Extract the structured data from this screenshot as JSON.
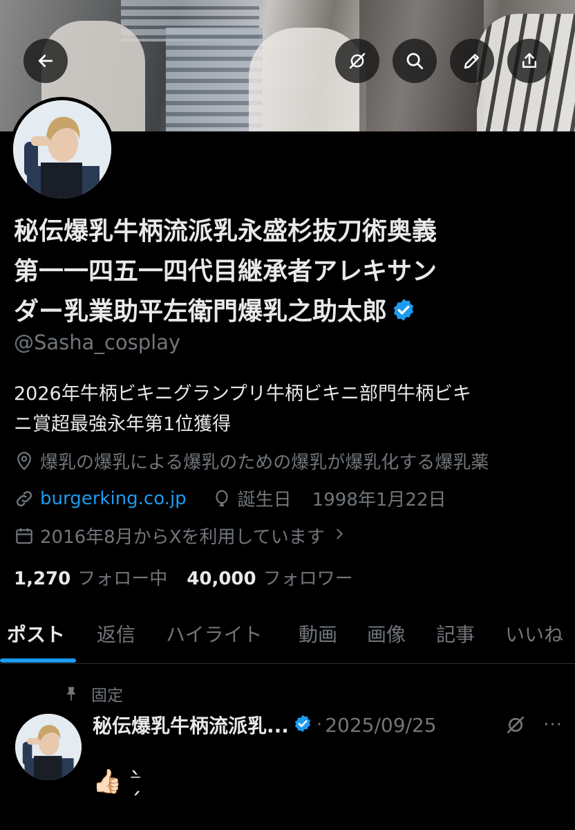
{
  "header": {
    "back_icon": "arrow-left-icon",
    "actions": [
      "grok-icon",
      "search-icon",
      "pencil-icon",
      "share-icon"
    ]
  },
  "profile": {
    "display_name_line1": "秘伝爆乳牛柄流派乳永盛杉抜刀術奥義",
    "display_name_line2": "第一一四五一四代目継承者アレキサン",
    "display_name_line3": "ダー乳業助平左衛門爆乳之助太郎",
    "verified": true,
    "handle": "@Sasha_cosplay",
    "bio_line1": "2026年牛柄ビキニグランプリ牛柄ビキニ部門牛柄ビキ",
    "bio_line2": "ニ賞超最強永年第1位獲得",
    "location": "爆乳の爆乳による爆乳のための爆乳が爆乳化する爆乳薬",
    "website": "burgerking.co.jp",
    "birthday_label": "誕生日",
    "birthday_date": "1998年1月22日",
    "joined": "2016年8月からXを利用しています",
    "following_count": "1,270",
    "following_label": "フォロー中",
    "followers_count": "40,000",
    "followers_label": "フォロワー"
  },
  "tabs": [
    {
      "label": "ポスト",
      "active": true
    },
    {
      "label": "返信",
      "active": false
    },
    {
      "label": "ハイライト",
      "active": false
    },
    {
      "label": "動画",
      "active": false
    },
    {
      "label": "画像",
      "active": false
    },
    {
      "label": "記事",
      "active": false
    },
    {
      "label": "いいね",
      "active": false
    }
  ],
  "pinned_post": {
    "pinned_label": "固定",
    "author_name": "秘伝爆乳牛柄流派乳...",
    "separator": "·",
    "date": "2025/09/25",
    "more": "···",
    "body": "👍🏻 ⁻̗̀"
  },
  "colors": {
    "accent": "#1d9bf0",
    "background": "#000000",
    "text": "#e7e9ea",
    "muted": "#71767b"
  }
}
